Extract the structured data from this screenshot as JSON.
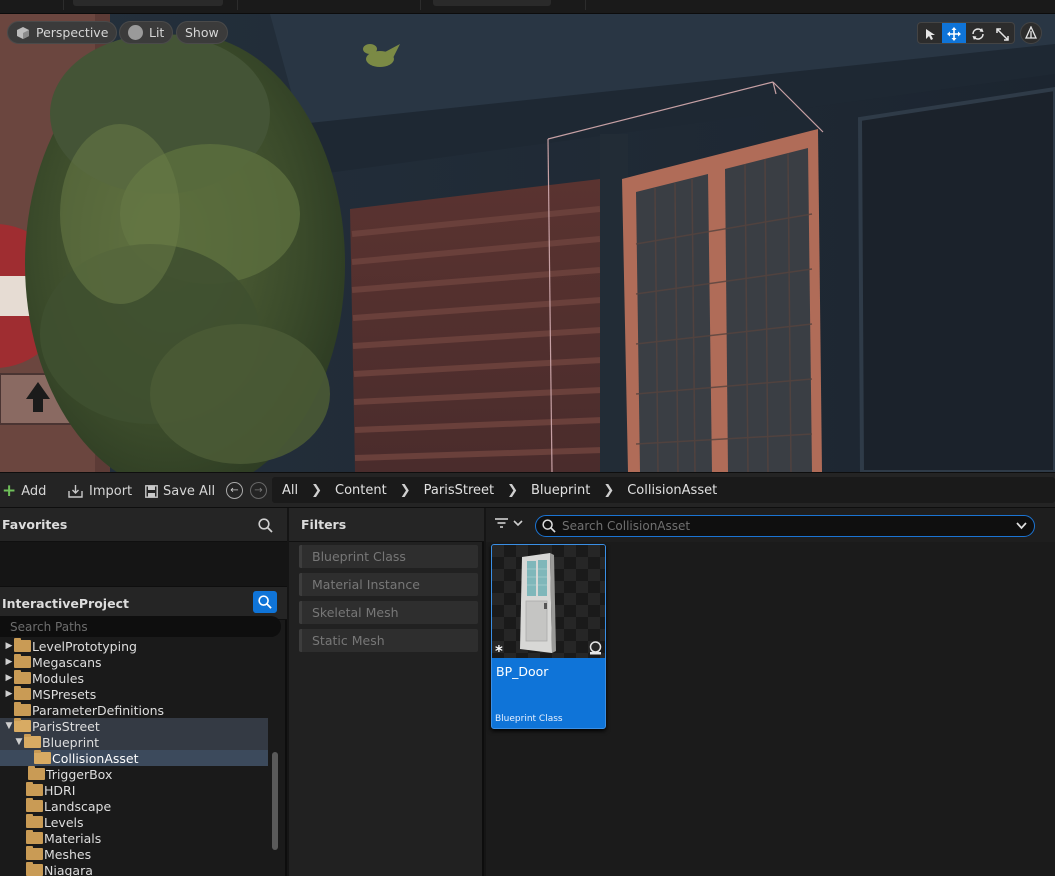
{
  "viewport": {
    "perspective_label": "Perspective",
    "lit_label": "Lit",
    "show_label": "Show"
  },
  "toolbar": {
    "add_label": "Add",
    "import_label": "Import",
    "save_all_label": "Save All"
  },
  "breadcrumb": [
    "All",
    "Content",
    "ParisStreet",
    "Blueprint",
    "CollisionAsset"
  ],
  "favorites": {
    "title": "Favorites"
  },
  "project": {
    "title": "InteractiveProject",
    "search_placeholder": "Search Paths"
  },
  "tree": [
    {
      "label": "LevelPrototyping",
      "arrow": "▶",
      "open": false
    },
    {
      "label": "Megascans",
      "arrow": "▶",
      "open": false
    },
    {
      "label": "Modules",
      "arrow": "▶",
      "open": false
    },
    {
      "label": "MSPresets",
      "arrow": "▶",
      "open": false
    },
    {
      "label": "ParameterDefinitions",
      "arrow": "",
      "open": false
    },
    {
      "label": "ParisStreet",
      "arrow": "▼",
      "open": true
    },
    {
      "label": "Blueprint",
      "arrow": "▼",
      "open": true
    },
    {
      "label": "CollisionAsset",
      "arrow": "",
      "open": true
    },
    {
      "label": "TriggerBox",
      "arrow": "",
      "open": false
    },
    {
      "label": "HDRI",
      "arrow": "",
      "open": false
    },
    {
      "label": "Landscape",
      "arrow": "",
      "open": false
    },
    {
      "label": "Levels",
      "arrow": "",
      "open": false
    },
    {
      "label": "Materials",
      "arrow": "",
      "open": false
    },
    {
      "label": "Meshes",
      "arrow": "",
      "open": false
    },
    {
      "label": "Niagara",
      "arrow": "",
      "open": false
    }
  ],
  "filters": {
    "title": "Filters",
    "items": [
      "Blueprint Class",
      "Material Instance",
      "Skeletal Mesh",
      "Static Mesh"
    ]
  },
  "assets": {
    "search_placeholder": "Search CollisionAsset",
    "items": [
      {
        "name": "BP_Door",
        "type": "Blueprint Class"
      }
    ]
  },
  "colors": {
    "accent": "#0f74d8",
    "folder": "#c99b55",
    "add_green": "#6fc05a"
  }
}
